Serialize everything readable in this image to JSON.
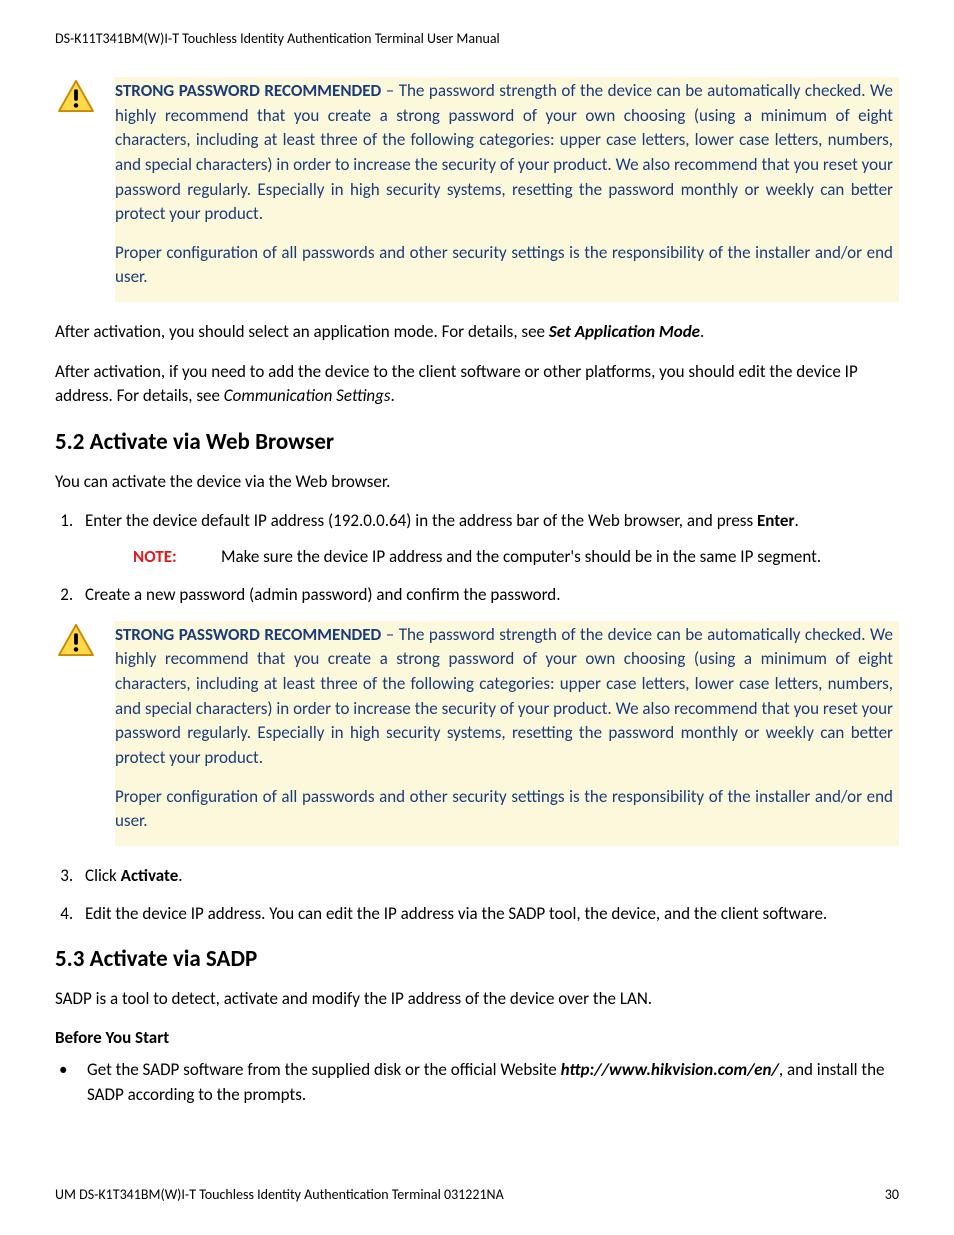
{
  "header": "DS-K11T341BM(W)I-T Touchless Identity Authentication Terminal User Manual",
  "warning": {
    "lead": "STRONG PASSWORD RECOMMENDED",
    "dash": " – ",
    "p1_rest": "The password strength of the device can be automatically checked. We highly recommend that you create a strong password of your own choosing (using a minimum of eight characters, including at least three of the following categories: upper case letters, lower case letters, numbers, and special characters) in order to increase the security of your product. We also recommend that you reset your password regularly. Especially in high security systems, resetting the password monthly or weekly can better protect your product.",
    "p2": "Proper configuration of all passwords and other security settings is the responsibility of the installer and/or end user."
  },
  "after1_a": "After activation, you should select an application mode. For details, see ",
  "after1_b": "Set Application Mode",
  "after1_c": ".",
  "after2_a": "After activation, if you need to add the device to the client software or other platforms, you should edit the device IP address. For details, see ",
  "after2_b": "Communication Settings",
  "after2_c": ".",
  "sec52": "5.2 Activate via Web Browser",
  "sec52_intro": "You can activate the device via the Web browser.",
  "step1_a": "Enter the device default IP address (192.0.0.64) in the address bar of the Web browser, and press ",
  "step1_b": "Enter",
  "step1_c": ".",
  "note_label": "NOTE:",
  "note_text": "Make sure the device IP address and the computer's should be in the same IP segment.",
  "step2": "Create a new password (admin password) and confirm the password.",
  "step3_a": "Click ",
  "step3_b": "Activate",
  "step3_c": ".",
  "step4": "Edit the device IP address. You can edit the IP address via the SADP tool, the device, and the client software.",
  "sec53": "5.3 Activate via SADP",
  "sec53_intro": "SADP is a tool to detect, activate and modify the IP address of the device over the LAN.",
  "before_label": "Before You Start",
  "bul1_a": "Get the SADP software from the supplied disk or the official Website ",
  "bul1_b": "http://www.hikvision.com/en/",
  "bul1_c": ", and install the SADP according to the prompts.",
  "footer_left": "UM DS-K1T341BM(W)I-T Touchless Identity Authentication Terminal 031221NA",
  "footer_right": "30"
}
